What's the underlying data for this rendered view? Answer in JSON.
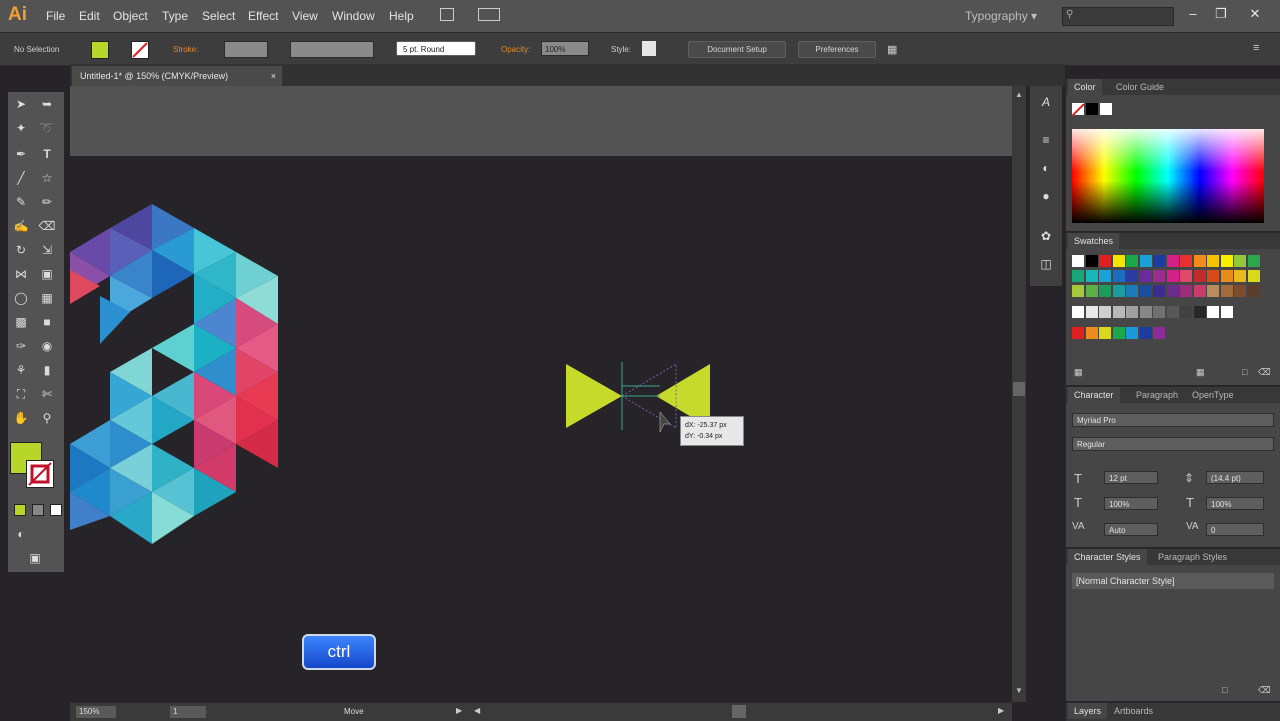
{
  "app": {
    "logo": "Ai",
    "workspace": "Typography ▾"
  },
  "menu": [
    "File",
    "Edit",
    "Object",
    "Type",
    "Select",
    "Effect",
    "View",
    "Window",
    "Help"
  ],
  "window_buttons": [
    "–",
    "❐",
    "✕"
  ],
  "control_bar": {
    "selection": "No Selection",
    "stroke_label": "Stroke:",
    "brush": "5 pt. Round",
    "opacity_label": "Opacity:",
    "opacity_value": "100%",
    "style_label": "Style:",
    "doc_setup": "Document Setup",
    "preferences": "Preferences"
  },
  "document_tab": {
    "title": "Untitled-1* @ 150% (CMYK/Preview)",
    "close": "×"
  },
  "status_bar": {
    "zoom": "150%",
    "artboard": "1",
    "tool": "Move"
  },
  "move_tooltip": {
    "dx": "dX: -25.37 px",
    "dy": "dY: -0.34 px"
  },
  "ctrl_key_label": "ctrl",
  "panels": {
    "color": {
      "tabs": [
        "Color",
        "Color Guide"
      ]
    },
    "swatches": {
      "title": "Swatches"
    },
    "character": {
      "tabs": [
        "Character",
        "Paragraph",
        "OpenType"
      ],
      "font": "Myriad Pro",
      "style": "Regular",
      "size": "12 pt",
      "leading": "(14.4 pt)",
      "vscale": "100%",
      "hscale": "100%",
      "kerning": "Auto",
      "tracking": "0"
    },
    "char_styles": {
      "tabs": [
        "Character Styles",
        "Paragraph Styles"
      ],
      "item": "[Normal Character Style]"
    },
    "layers": {
      "tabs": [
        "Layers",
        "Artboards"
      ]
    }
  },
  "colors": {
    "fill": "#b8d62a",
    "accent_orange": "#f0a030",
    "bowtie": "#c6da2c"
  }
}
